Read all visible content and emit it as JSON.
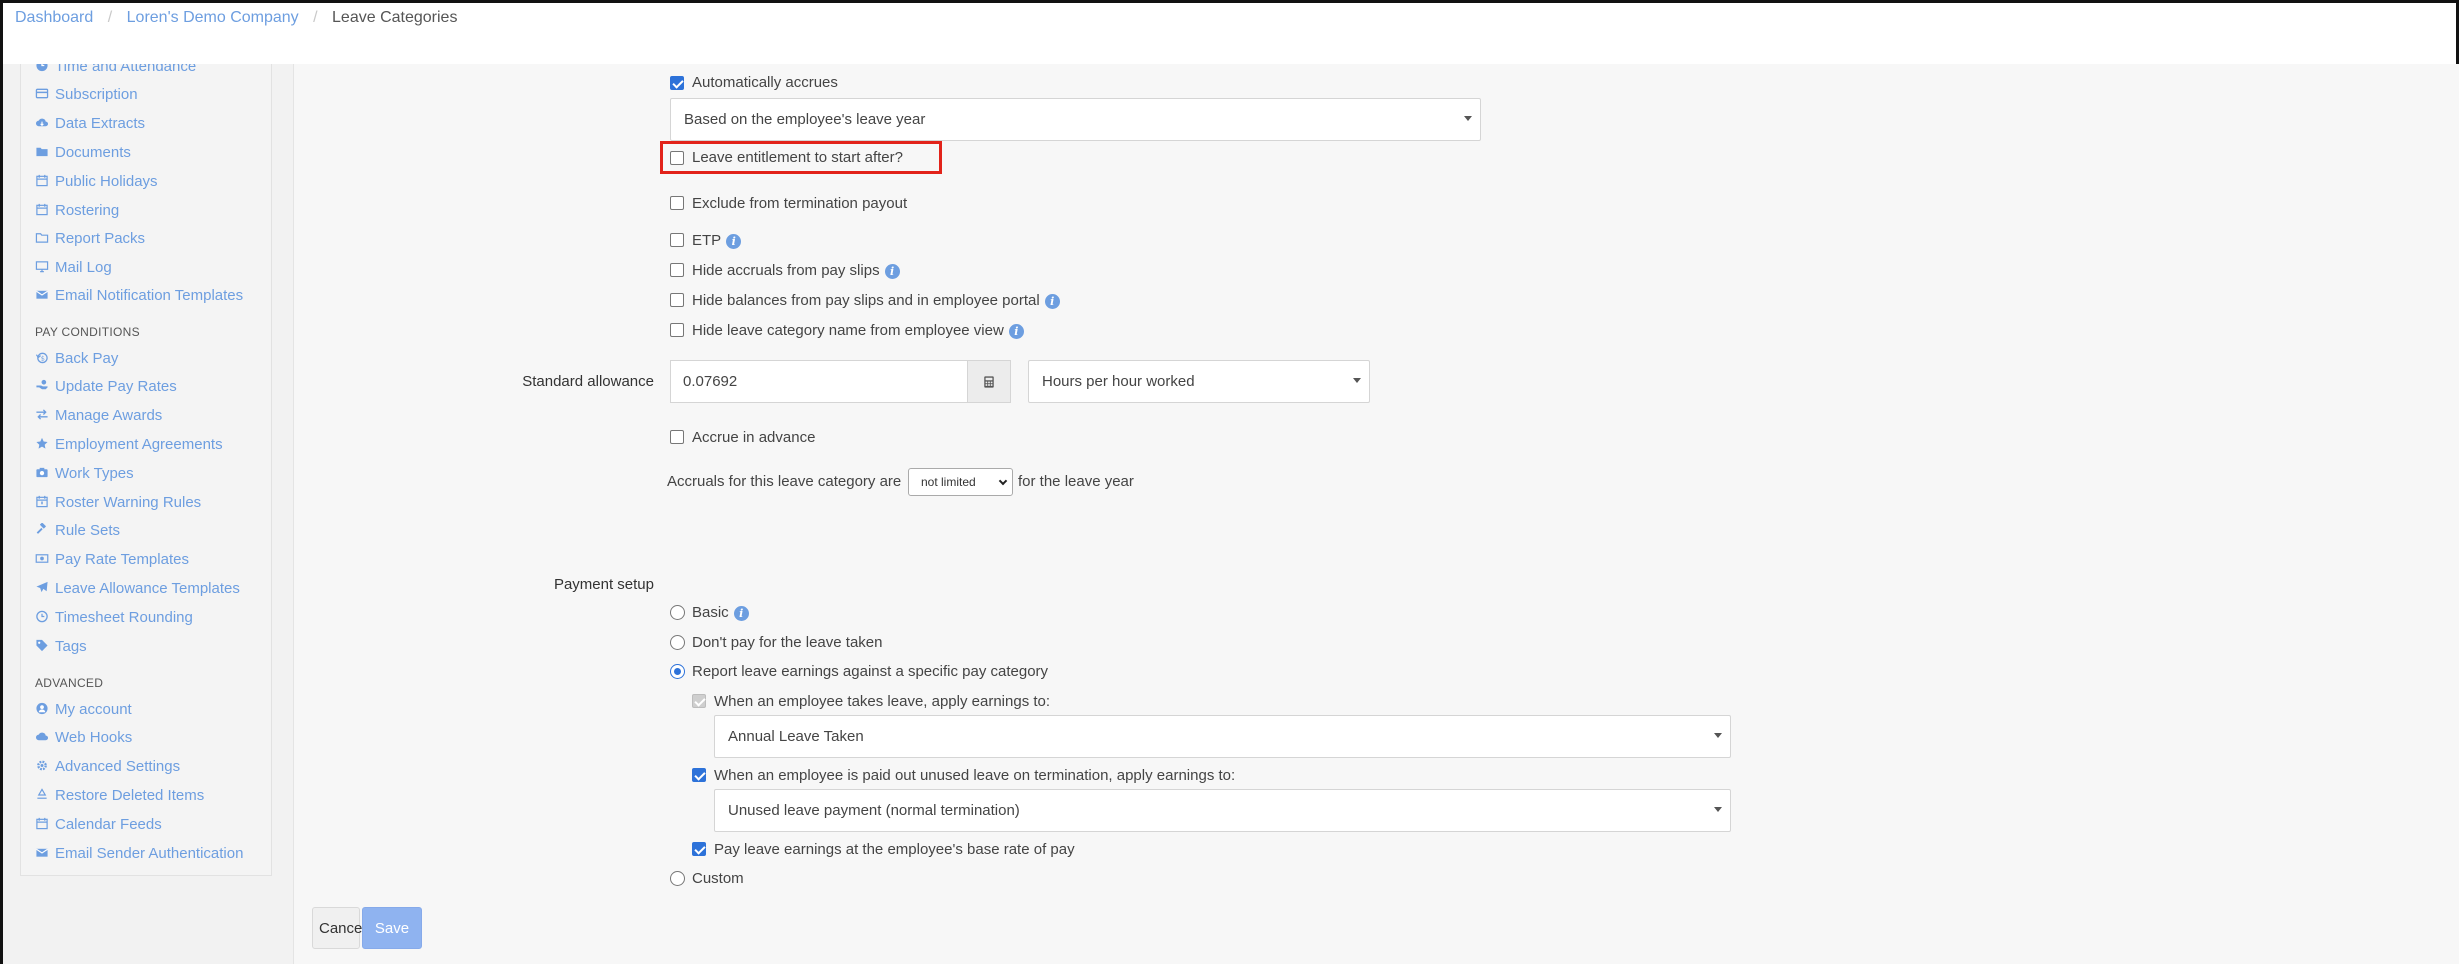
{
  "breadcrumb": {
    "items": [
      "Dashboard",
      "Loren's Demo Company"
    ],
    "current": "Leave Categories",
    "separator": "/"
  },
  "sidebar": {
    "items_top": [
      {
        "label": "Time and Attendance",
        "icon": "clock-icon"
      },
      {
        "label": "Subscription",
        "icon": "credit-card-icon"
      },
      {
        "label": "Data Extracts",
        "icon": "cloud-download-icon"
      },
      {
        "label": "Documents",
        "icon": "folder-icon"
      },
      {
        "label": "Public Holidays",
        "icon": "calendar-icon"
      },
      {
        "label": "Rostering",
        "icon": "calendar-icon"
      },
      {
        "label": "Report Packs",
        "icon": "folder-open-icon"
      },
      {
        "label": "Mail Log",
        "icon": "monitor-icon"
      },
      {
        "label": "Email Notification Templates",
        "icon": "envelope-icon"
      }
    ],
    "section_pay": "PAY CONDITIONS",
    "items_pay": [
      {
        "label": "Back Pay",
        "icon": "back-pay-icon"
      },
      {
        "label": "Update Pay Rates",
        "icon": "hand-money-icon"
      },
      {
        "label": "Manage Awards",
        "icon": "exchange-icon"
      },
      {
        "label": "Employment Agreements",
        "icon": "star-icon"
      },
      {
        "label": "Work Types",
        "icon": "camera-icon"
      },
      {
        "label": "Roster Warning Rules",
        "icon": "calendar-warning-icon"
      },
      {
        "label": "Rule Sets",
        "icon": "gavel-icon"
      },
      {
        "label": "Pay Rate Templates",
        "icon": "money-icon"
      },
      {
        "label": "Leave Allowance Templates",
        "icon": "plane-icon"
      },
      {
        "label": "Timesheet Rounding",
        "icon": "clock-icon"
      },
      {
        "label": "Tags",
        "icon": "tag-icon"
      }
    ],
    "section_advanced": "ADVANCED",
    "items_advanced": [
      {
        "label": "My account",
        "icon": "user-icon"
      },
      {
        "label": "Web Hooks",
        "icon": "cloud-icon"
      },
      {
        "label": "Advanced Settings",
        "icon": "gear-icon"
      },
      {
        "label": "Restore Deleted Items",
        "icon": "recycle-icon"
      },
      {
        "label": "Calendar Feeds",
        "icon": "calendar-icon"
      },
      {
        "label": "Email Sender Authentication",
        "icon": "envelope-icon"
      }
    ]
  },
  "form": {
    "auto_accrues_label": "Automatically accrues",
    "accrual_basis_value": "Based on the employee's leave year",
    "entitlement_start_label": "Leave entitlement to start after?",
    "exclude_termination_label": "Exclude from termination payout",
    "etp_label": "ETP",
    "hide_accruals_label": "Hide accruals from pay slips",
    "hide_balances_label": "Hide balances from pay slips and in employee portal",
    "hide_name_label": "Hide leave category name from employee view",
    "standard_allowance_label": "Standard allowance",
    "standard_allowance_value": "0.07692",
    "allowance_unit_value": "Hours per hour worked",
    "accrue_advance_label": "Accrue in advance",
    "accruals_prefix": "Accruals for this leave category are",
    "accruals_limit_value": "not limited",
    "accruals_suffix": "for the leave year",
    "payment_setup_label": "Payment setup",
    "payment_basic_label": "Basic",
    "payment_dont_pay_label": "Don't pay for the leave taken",
    "payment_report_label": "Report leave earnings against a specific pay category",
    "takes_leave_label": "When an employee takes leave, apply earnings to:",
    "takes_leave_value": "Annual Leave Taken",
    "paid_out_label": "When an employee is paid out unused leave on termination, apply earnings to:",
    "paid_out_value": "Unused leave payment (normal termination)",
    "base_rate_label": "Pay leave earnings at the employee's base rate of pay",
    "payment_custom_label": "Custom"
  },
  "buttons": {
    "cancel": "Cancel",
    "save": "Save"
  },
  "colors": {
    "link": "#6d9ee0",
    "checkbox_checked": "#2d72d9",
    "highlight": "#e2231a",
    "save_button": "#8fb3f0"
  }
}
